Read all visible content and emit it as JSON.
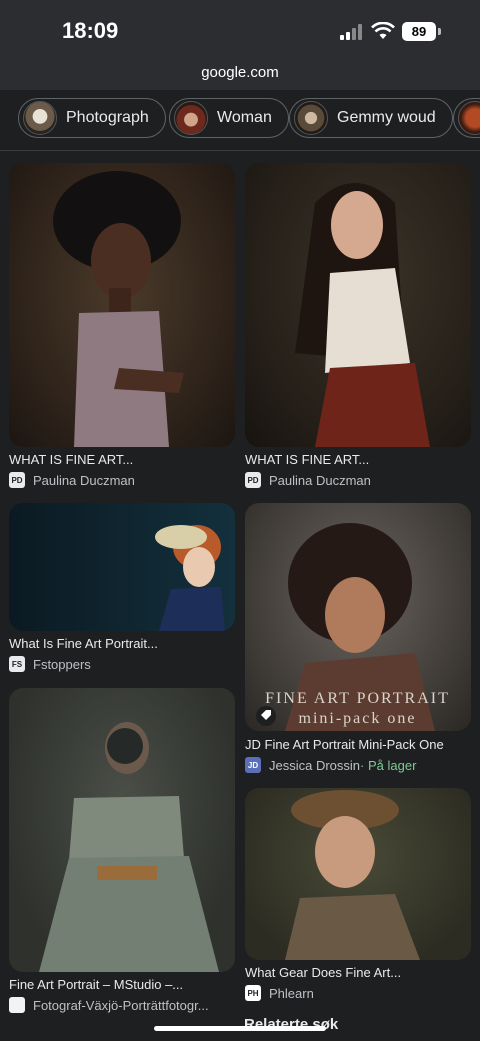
{
  "status": {
    "time": "18:09",
    "battery": "89"
  },
  "browser": {
    "url": "google.com"
  },
  "chips": [
    {
      "label": "Photograph"
    },
    {
      "label": "Woman"
    },
    {
      "label": "Gemmy woud"
    }
  ],
  "results": [
    {
      "caption": "WHAT IS FINE ART...",
      "source": "Paulina Duczman",
      "favicon": "PD"
    },
    {
      "caption": "WHAT IS FINE ART...",
      "source": "Paulina Duczman",
      "favicon": "PD"
    },
    {
      "caption": "What Is Fine Art Portrait...",
      "source": "Fstoppers",
      "favicon": "FS"
    },
    {
      "caption": "JD Fine Art Portrait Mini-Pack One",
      "source": "Jessica Drossin",
      "extra": " · På lager",
      "favicon": "JD",
      "overlay_title": "FINE ART PORTRAIT",
      "overlay_sub": "mini-pack one"
    },
    {
      "caption": "Fine Art Portrait – MStudio –...",
      "source": "Fotograf-Växjö-Porträttfotogr...",
      "favicon": ""
    },
    {
      "caption": "What Gear Does Fine Art...",
      "source": "Phlearn",
      "favicon": "PH"
    }
  ],
  "related": "Relaterte søk",
  "colors": {
    "background": "#1e1f21",
    "chrome": "#2b2d30",
    "in_stock": "#81c995"
  }
}
